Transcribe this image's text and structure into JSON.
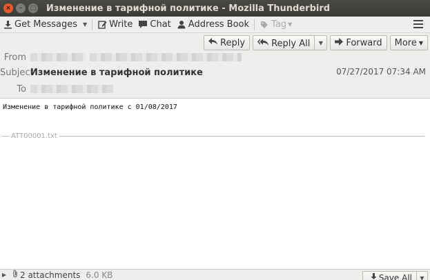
{
  "window": {
    "title": "Изменение в тарифной политике - Mozilla Thunderbird",
    "close_glyph": "×",
    "min_glyph": "–",
    "max_glyph": "□"
  },
  "toolbar": {
    "get_messages": "Get Messages",
    "write": "Write",
    "chat": "Chat",
    "address_book": "Address Book",
    "tag": "Tag"
  },
  "actions": {
    "reply": "Reply",
    "reply_all": "Reply All",
    "forward": "Forward",
    "more": "More"
  },
  "header": {
    "from_label": "From",
    "subject_label": "Subject",
    "subject": "Изменение в тарифной политике",
    "to_label": "To",
    "date": "07/27/2017 07:34 AM"
  },
  "body": {
    "text": "Изменение в тарифной политике с 01/08/2017",
    "attachment_separator_name": "ATT00001.txt"
  },
  "attachment_bar": {
    "count": "2 attachments",
    "size": "6.0 KB",
    "save_all": "Save All"
  },
  "icons": {
    "get_messages": "download-icon",
    "write": "pencil-icon",
    "chat": "chat-bubble-icon",
    "address_book": "contact-icon",
    "tag": "tag-icon",
    "reply": "reply-arrow-icon",
    "reply_all": "reply-all-arrow-icon",
    "forward": "forward-arrow-icon",
    "attachment": "paperclip-icon",
    "save": "save-download-icon"
  },
  "colors": {
    "titlebar": "#3c3b37",
    "close_button": "#e65a2d",
    "chrome": "#efeeec"
  }
}
